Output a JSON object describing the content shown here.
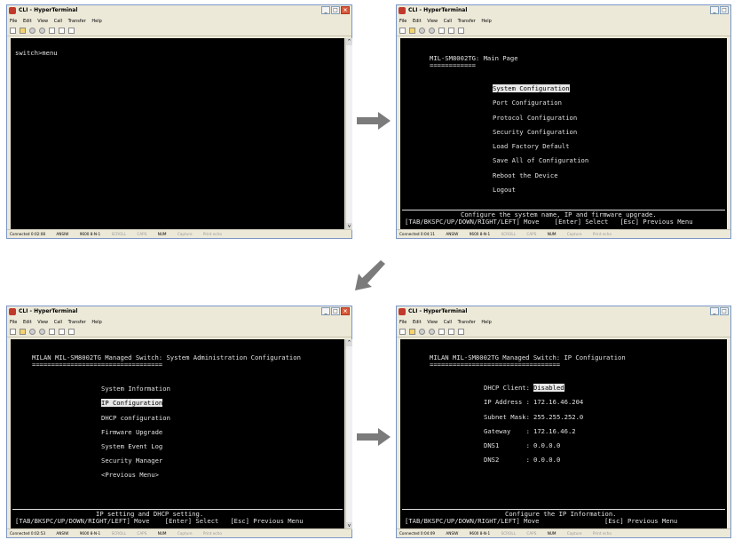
{
  "window": {
    "title": "CLI - HyperTerminal",
    "menu": [
      "File",
      "Edit",
      "View",
      "Call",
      "Transfer",
      "Help"
    ]
  },
  "panel1": {
    "prompt": "switch>menu",
    "status": {
      "connected": "Connected 0:02:08",
      "emulation": "ANSIW",
      "port": "9600 8-N-1",
      "scroll": "SCROLL",
      "caps": "CAPS",
      "num": "NUM",
      "capture": "Capture",
      "print": "Print echo"
    }
  },
  "panel2": {
    "header": "MIL-SM8002TG: Main Page",
    "underline": "============",
    "items": [
      "System Configuration",
      "Port Configuration",
      "Protocol Configuration",
      "Security Configuration",
      "Load Factory Default",
      "Save All of Configuration",
      "Reboot the Device",
      "Logout"
    ],
    "hint": "Configure the system name, IP and firmware upgrade.",
    "keys": "[TAB/BKSPC/UP/DOWN/RIGHT/LEFT] Move    [Enter] Select   [Esc] Previous Menu",
    "status": {
      "connected": "Connected 0:04:11",
      "emulation": "ANSIW",
      "port": "9600 8-N-1",
      "scroll": "SCROLL",
      "caps": "CAPS",
      "num": "NUM",
      "capture": "Capture",
      "print": "Print echo"
    }
  },
  "panel3": {
    "header": "MILAN MIL-SM8002TG Managed Switch: System Administration Configuration",
    "underline": "==================================",
    "items": [
      "System Information",
      "IP Configuration",
      "DHCP configuration",
      "Firmware Upgrade",
      "System Event Log",
      "Security Manager",
      "<Previous Menu>"
    ],
    "hint": "IP setting and DHCP setting.",
    "keys": "[TAB/BKSPC/UP/DOWN/RIGHT/LEFT] Move    [Enter] Select   [Esc] Previous Menu",
    "status": {
      "connected": "Connected 0:02:53",
      "emulation": "ANSIW",
      "port": "9600 8-N-1",
      "scroll": "SCROLL",
      "caps": "CAPS",
      "num": "NUM",
      "capture": "Capture",
      "print": "Print echo"
    }
  },
  "panel4": {
    "header": "MILAN MIL-SM8002TG Managed Switch: IP Configuration",
    "underline": "==================================",
    "fields": [
      {
        "label": "DHCP Client:",
        "value": "Disabled"
      },
      {
        "label": "IP Address :",
        "value": "172.16.46.204"
      },
      {
        "label": "Subnet Mask:",
        "value": "255.255.252.0"
      },
      {
        "label": "Gateway    :",
        "value": "172.16.46.2"
      },
      {
        "label": "DNS1       :",
        "value": "0.0.0.0"
      },
      {
        "label": "DNS2       :",
        "value": "0.0.0.0"
      }
    ],
    "hint": "Configure the IP Information.",
    "keys": "[TAB/BKSPC/UP/DOWN/RIGHT/LEFT] Move                 [Esc] Previous Menu",
    "status": {
      "connected": "Connected 0:04:09",
      "emulation": "ANSIW",
      "port": "9600 8-N-1",
      "scroll": "SCROLL",
      "caps": "CAPS",
      "num": "NUM",
      "capture": "Capture",
      "print": "Print echo"
    }
  },
  "arrow_color": "#7b7b7b"
}
